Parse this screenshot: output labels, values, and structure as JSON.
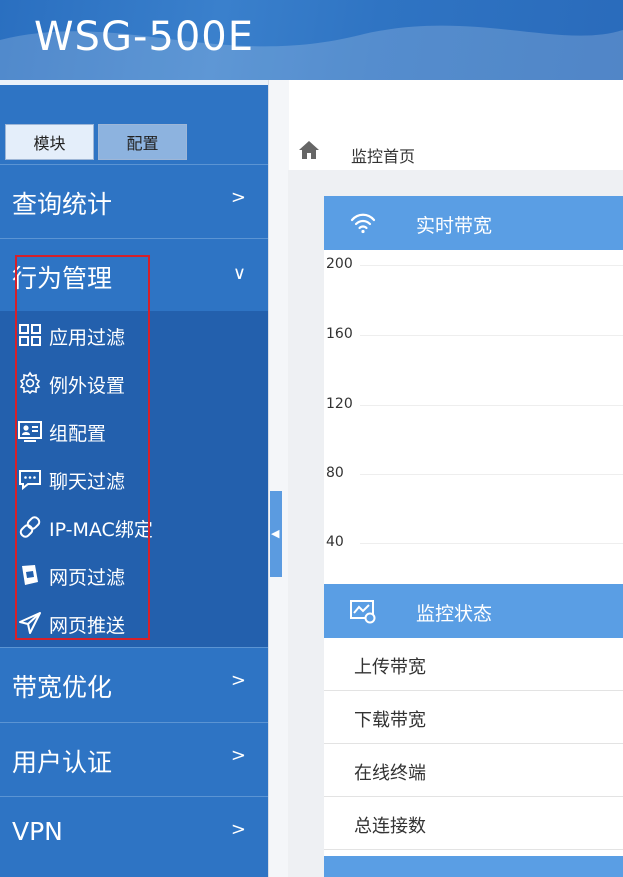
{
  "header": {
    "title": "WSG-500E"
  },
  "tabs": [
    {
      "label": "模块"
    },
    {
      "label": "配置"
    }
  ],
  "menu": {
    "query": "查询统计",
    "behavior": "行为管理",
    "bandwidth": "带宽优化",
    "auth": "用户认证",
    "vpn": "VPN"
  },
  "submenu": [
    {
      "label": "应用过滤",
      "icon": "grid-icon"
    },
    {
      "label": "例外设置",
      "icon": "gear-icon"
    },
    {
      "label": "组配置",
      "icon": "contact-card-icon"
    },
    {
      "label": "聊天过滤",
      "icon": "chat-icon"
    },
    {
      "label": "IP-MAC绑定",
      "icon": "link-icon"
    },
    {
      "label": "网页过滤",
      "icon": "page-icon"
    },
    {
      "label": "网页推送",
      "icon": "send-icon"
    }
  ],
  "breadcrumb": {
    "label": "监控首页"
  },
  "realtime": {
    "title": "实时带宽",
    "chart_data": {
      "type": "line",
      "title": "实时带宽",
      "yticks": [
        "200",
        "160",
        "120",
        "80",
        "40"
      ],
      "grid": true
    }
  },
  "monitor": {
    "title": "监控状态",
    "rows": [
      "上传带宽",
      "下载带宽",
      "在线终端",
      "总连接数"
    ]
  },
  "colors": {
    "brand": "#2e74c4",
    "panel_header": "#5a9ee4",
    "highlight": "#d6202a"
  }
}
